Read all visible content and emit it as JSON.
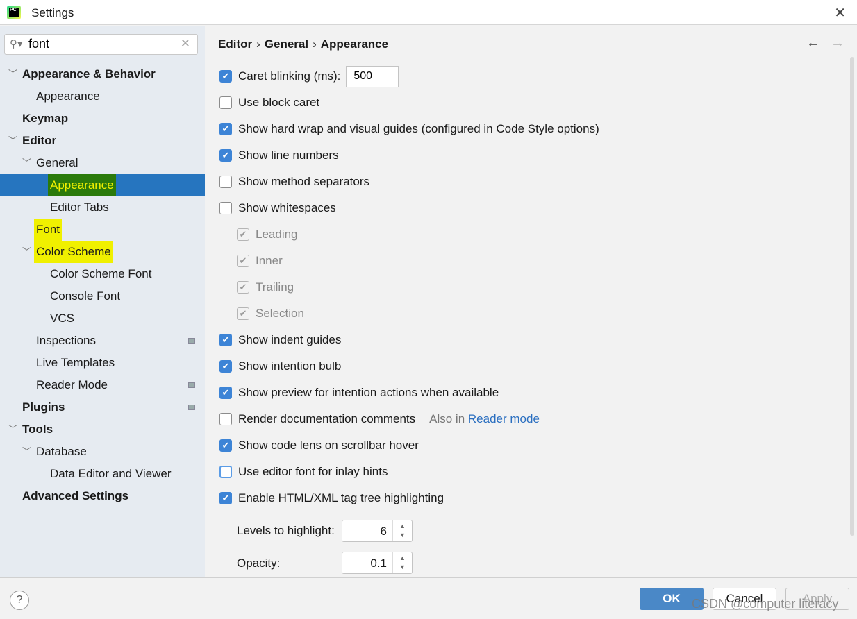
{
  "window": {
    "title": "Settings",
    "close_icon": "close-icon"
  },
  "search": {
    "value": "font"
  },
  "tree": [
    {
      "label": "Appearance & Behavior",
      "level": 0,
      "bold": true,
      "chev": true
    },
    {
      "label": "Appearance",
      "level": 1
    },
    {
      "label": "Keymap",
      "level": 0,
      "bold": true
    },
    {
      "label": "Editor",
      "level": 0,
      "bold": true,
      "chev": true
    },
    {
      "label": "General",
      "level": 1,
      "chev": true
    },
    {
      "label": "Appearance",
      "level": 2,
      "selected": true,
      "highlight": "green"
    },
    {
      "label": "Editor Tabs",
      "level": 2
    },
    {
      "label": "Font",
      "level": 1,
      "highlight": "yellow"
    },
    {
      "label": "Color Scheme",
      "level": 1,
      "chev": true,
      "highlight": "yellow"
    },
    {
      "label": "Color Scheme Font",
      "level": 2
    },
    {
      "label": "Console Font",
      "level": 2
    },
    {
      "label": "VCS",
      "level": 2
    },
    {
      "label": "Inspections",
      "level": 1,
      "badge": true
    },
    {
      "label": "Live Templates",
      "level": 1
    },
    {
      "label": "Reader Mode",
      "level": 1,
      "badge": true
    },
    {
      "label": "Plugins",
      "level": 0,
      "bold": true,
      "badge": true
    },
    {
      "label": "Tools",
      "level": 0,
      "bold": true,
      "chev": true
    },
    {
      "label": "Database",
      "level": 1,
      "chev": true
    },
    {
      "label": "Data Editor and Viewer",
      "level": 2
    },
    {
      "label": "Advanced Settings",
      "level": 0,
      "bold": true
    }
  ],
  "breadcrumb": [
    "Editor",
    "General",
    "Appearance"
  ],
  "options": [
    {
      "label": "Caret blinking (ms):",
      "checked": true,
      "input": "500"
    },
    {
      "label": "Use block caret",
      "checked": false
    },
    {
      "label": "Show hard wrap and visual guides (configured in Code Style options)",
      "checked": true
    },
    {
      "label": "Show line numbers",
      "checked": true
    },
    {
      "label": "Show method separators",
      "checked": false
    },
    {
      "label": "Show whitespaces",
      "checked": false
    },
    {
      "label": "Leading",
      "checked": true,
      "disabled": true,
      "indent": true
    },
    {
      "label": "Inner",
      "checked": true,
      "disabled": true,
      "indent": true
    },
    {
      "label": "Trailing",
      "checked": true,
      "disabled": true,
      "indent": true
    },
    {
      "label": "Selection",
      "checked": true,
      "disabled": true,
      "indent": true
    },
    {
      "label": "Show indent guides",
      "checked": true
    },
    {
      "label": "Show intention bulb",
      "checked": true
    },
    {
      "label": "Show preview for intention actions when available",
      "checked": true
    },
    {
      "label": "Render documentation comments",
      "checked": false,
      "hint": "Also in",
      "link": "Reader mode"
    },
    {
      "label": "Show code lens on scrollbar hover",
      "checked": true
    },
    {
      "label": "Use editor font for inlay hints",
      "checked": false,
      "focused": true
    },
    {
      "label": "Enable HTML/XML tag tree highlighting",
      "checked": true
    }
  ],
  "levels": {
    "label": "Levels to highlight:",
    "value": "6"
  },
  "opacity": {
    "label": "Opacity:",
    "value": "0.1"
  },
  "footer": {
    "help": "?",
    "ok": "OK",
    "cancel": "Cancel",
    "apply": "Apply"
  },
  "watermark": "CSDN @computer literacy",
  "colors": {
    "accent": "#2675bf",
    "checkbox": "#3d84d6",
    "highlight": "#f0f000"
  }
}
